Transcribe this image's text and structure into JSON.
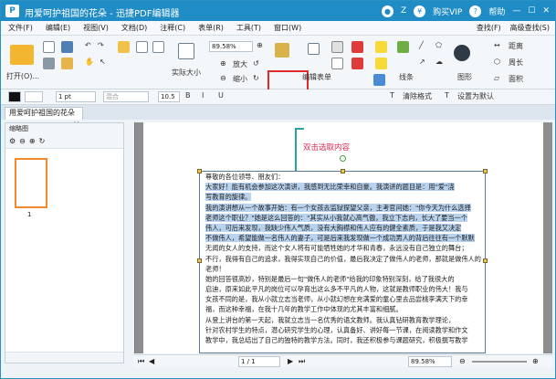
{
  "window": {
    "title": "用爱呵护祖国的花朵 - 迅捷PDF编辑器",
    "logo": "P",
    "user_label": "Z",
    "buy_vip": "购买VIP",
    "help": "帮助"
  },
  "menu": {
    "items": [
      "文件(F)",
      "编辑(E)",
      "视图(V)",
      "文档(D)",
      "注释(C)",
      "表单(R)",
      "工具(T)",
      "窗口(W)"
    ],
    "right": [
      "查找(F)",
      "高级查找(S)"
    ]
  },
  "ribbon": {
    "open": "打开(O)...",
    "actual_size": "实际大小",
    "zoom_value": "89.58%",
    "zoom_in": "放大",
    "zoom_out": "缩小",
    "edit_form": "编辑表单",
    "line": "线条",
    "graph": "图形",
    "dist": "距离",
    "circ": "周长",
    "area": "面积"
  },
  "format": {
    "font_size": "10.5",
    "line_width": "1 pt",
    "blend": "混合",
    "clear_format": "清除格式",
    "default_tool": "设置为默认"
  },
  "tab": {
    "doc_name": "用爱呵护祖国的花朵",
    "close": "×"
  },
  "left_panel": {
    "title": "缩略图",
    "page_number": "1"
  },
  "document": {
    "hint": "双击选取内容",
    "lines": [
      {
        "t": "尊敬的各位领导、朋友们：",
        "hl": false
      },
      {
        "t": "    大家好！能有机会参加这次演讲，我感到无比荣幸和自豪。我演讲的题目是：用\"爱\"浇",
        "hl": true
      },
      {
        "t": "写教育的旋律。",
        "hl": true
      },
      {
        "t": "    我的演讲想从一个故事开始：有一个女孩去监狱探望父亲，主考官问她：\"你今天为什么选择",
        "hl": true
      },
      {
        "t": "老师这个职业？\"她是这么回答的：\"其实从小我就心高气傲，我立下志向，长大了要当一个",
        "hl": true
      },
      {
        "t": "伟人，可后来发现，我缺少伟人气质，没有大胸襟和伟人应有的健全素质，于是我又决定",
        "hl": true
      },
      {
        "t": "不做伟人，希望能做一名伟人的妻子，可是后来我发现做一个成功男人的背后往往有一个默默",
        "hl": true
      },
      {
        "t": "无闻的女人的支持，而这个女人将有可能牺牲她的才华和青春，永远没有自己独立的舞台；",
        "hl": false
      },
      {
        "t": "不行，我得有自己的追求，我得实现自己的价值，最后我决定了做伟人的老师，那就是做伟人的",
        "hl": false
      },
      {
        "t": "老师！",
        "hl": false
      },
      {
        "t": "    她的回答很高妙，特别是最后一句\"做伟人的老师\"给我的印象特别深刻，给了我很大的",
        "hl": false
      },
      {
        "t": "启迪，原来如此平凡的岗位可以孕育出这么多不平凡的人物，这就是教师职业的伟大！我与",
        "hl": false
      },
      {
        "t": "女孩不同的是，我从小就立志当老师，从小就幻想在充满爱的童心里去品尝桃李满天下的幸",
        "hl": false
      },
      {
        "t": "福，而这种幸福，在我十几年的教学工作中体现的尤其丰富和细腻。",
        "hl": false
      },
      {
        "t": "    从登上讲台的第一天起，我就立志当一名优秀的语文教师。我认真钻研教育教学理论，",
        "hl": false
      },
      {
        "t": "针对农村学生的特点，潜心研究学生的心理，认真备好、讲好每一节课，在阅读教学和作文",
        "hl": false
      },
      {
        "t": "教学中，我总结出了自己的独特的教学方法。同时，我还积极参与课题研究，积极撰写教学",
        "hl": false
      }
    ]
  },
  "status": {
    "page_indicator": "1 / 1",
    "zoom": "89.58%"
  },
  "colors": {
    "titlebar": "#1f8cc6",
    "highlight": "#b9d3ef",
    "hint": "#e0294f",
    "arrow": "#2aa3a6",
    "thumb_border": "#f08a2c",
    "red_frame": "#e02b2b"
  }
}
